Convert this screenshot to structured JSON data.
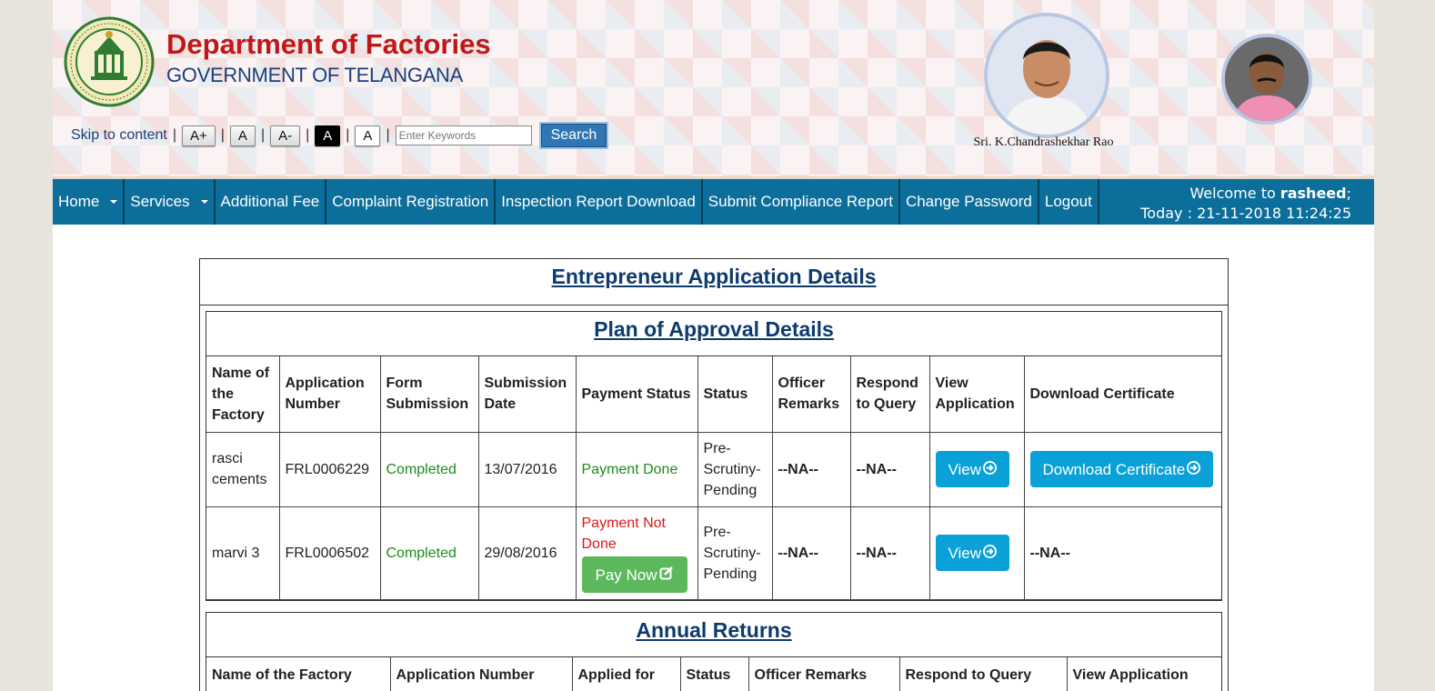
{
  "header": {
    "dept_title": "Department of Factories",
    "gov_title": "GOVERNMENT OF TELANGANA",
    "skip_link": "Skip to content",
    "font_buttons": [
      "A+",
      "A",
      "A-",
      "A",
      "A"
    ],
    "search_placeholder": "Enter Keywords",
    "search_button": "Search",
    "cm_name": "Sri. K.Chandrashekhar Rao"
  },
  "nav": {
    "items": [
      "Home",
      "Services",
      "Additional Fee",
      "Complaint Registration",
      "Inspection Report Download",
      "Submit Compliance Report",
      "Change Password",
      "Logout"
    ],
    "welcome_prefix": "Welcome to ",
    "username": "rasheed",
    "welcome_suffix": ";",
    "today": "Today : 21-11-2018 11:24:25"
  },
  "main": {
    "title": "Entrepreneur Application Details",
    "plan": {
      "title": "Plan of Approval Details",
      "headers": [
        "Name of the Factory",
        "Application Number",
        "Form Submission",
        "Submission Date",
        "Payment Status",
        "Status",
        "Officer Remarks",
        "Respond to Query",
        "View Application",
        "Download Certificate"
      ],
      "rows": [
        {
          "name": "rasci cements",
          "app_no": "FRL0006229",
          "form": "Completed",
          "date": "13/07/2016",
          "payment": "Payment Done",
          "status": "Pre-Scrutiny-Pending",
          "remarks": "--NA--",
          "respond": "--NA--",
          "view": "View",
          "download": "Download Certificate"
        },
        {
          "name": "marvi 3",
          "app_no": "FRL0006502",
          "form": "Completed",
          "date": "29/08/2016",
          "payment": "Payment Not Done",
          "pay_button": "Pay Now",
          "status": "Pre-Scrutiny-Pending",
          "remarks": "--NA--",
          "respond": "--NA--",
          "view": "View",
          "download": "--NA--"
        }
      ]
    },
    "annual": {
      "title": "Annual Returns",
      "headers": [
        "Name of the Factory",
        "Application Number",
        "Applied for",
        "Status",
        "Officer Remarks",
        "Respond to Query",
        "View Application"
      ]
    }
  },
  "colors": {
    "nav_bg": "#0c6e9a",
    "title_red": "#c01818",
    "completed_green": "#1e8c1e",
    "not_done_red": "#e01414",
    "view_blue": "#0aa0d8",
    "pay_green": "#5cb85c"
  }
}
